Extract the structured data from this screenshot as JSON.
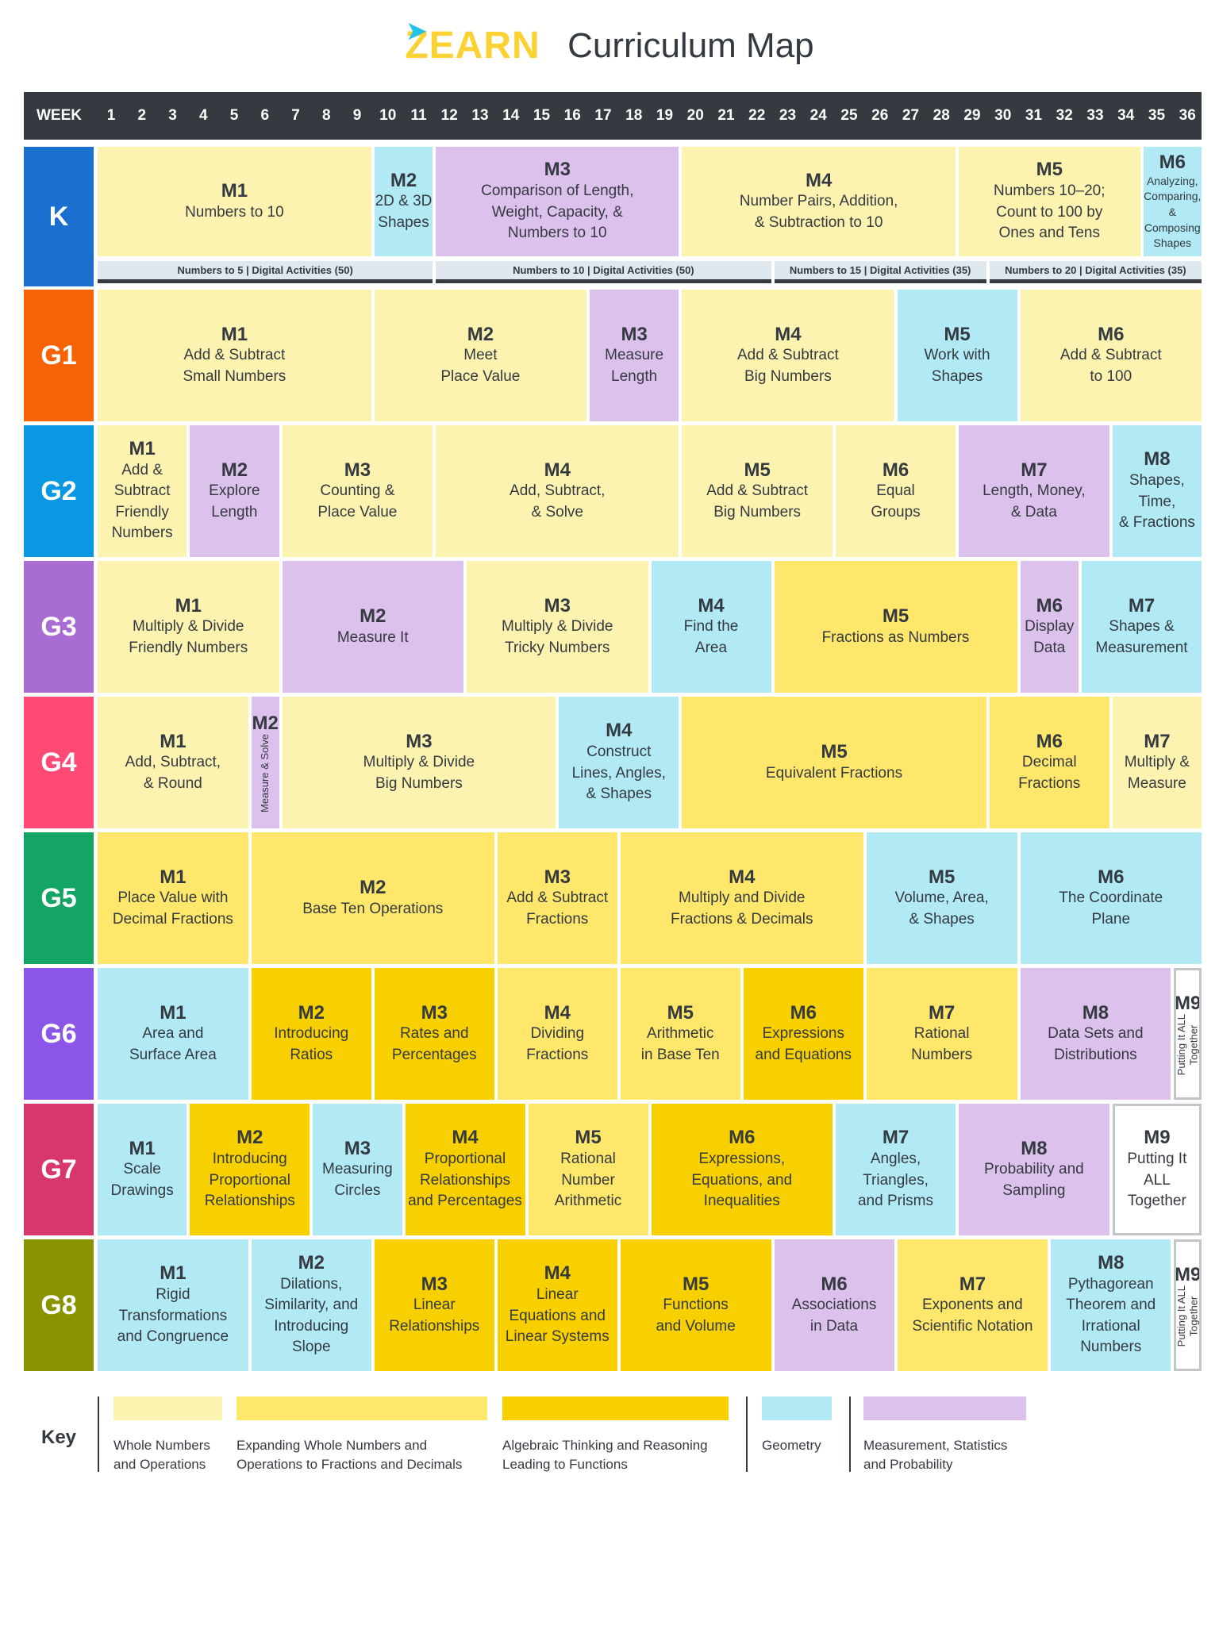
{
  "header": {
    "logo_text": "ZEARN",
    "title": "Curriculum Map"
  },
  "week_bar": {
    "label": "WEEK",
    "weeks": [
      "1",
      "2",
      "3",
      "4",
      "5",
      "6",
      "7",
      "8",
      "9",
      "10",
      "11",
      "12",
      "13",
      "14",
      "15",
      "16",
      "17",
      "18",
      "19",
      "20",
      "21",
      "22",
      "23",
      "24",
      "25",
      "26",
      "27",
      "28",
      "29",
      "30",
      "31",
      "32",
      "33",
      "34",
      "35",
      "36"
    ]
  },
  "colors": {
    "whole": "#fdf3b0",
    "expanding": "#fee76a",
    "algebraic": "#f8d000",
    "geometry": "#b1eaf5",
    "measurement": "#dbc1ec",
    "outline": "#ffffff",
    "header_bg": "#343a40"
  },
  "grades": [
    {
      "label": "K",
      "color": "#1b6fce",
      "modules": [
        {
          "code": "M1",
          "name": "Numbers to 10",
          "start": 1,
          "end": 9,
          "cat": "whole"
        },
        {
          "code": "M2",
          "name": "2D & 3D\nShapes",
          "start": 10,
          "end": 11,
          "cat": "geometry"
        },
        {
          "code": "M3",
          "name": "Comparison of Length,\nWeight, Capacity, &\nNumbers to 10",
          "start": 12,
          "end": 19,
          "cat": "measurement"
        },
        {
          "code": "M4",
          "name": "Number Pairs, Addition,\n& Subtraction to 10",
          "start": 20,
          "end": 28,
          "cat": "whole"
        },
        {
          "code": "M5",
          "name": "Numbers 10–20;\nCount to 100 by\nOnes and Tens",
          "start": 29,
          "end": 34,
          "cat": "whole"
        },
        {
          "code": "M6",
          "name": "Analyzing,\nComparing,\n& Composing\nShapes",
          "start": 35,
          "end": 36,
          "cat": "geometry",
          "style": "small"
        }
      ],
      "subbars": [
        {
          "text": "Numbers to 5 | Digital Activities (50)",
          "start": 1,
          "end": 11
        },
        {
          "text": "Numbers to 10 | Digital Activities (50)",
          "start": 12,
          "end": 22
        },
        {
          "text": "Numbers to 15 | Digital Activities (35)",
          "start": 23,
          "end": 29
        },
        {
          "text": "Numbers to 20 | Digital Activities (35)",
          "start": 30,
          "end": 36
        }
      ]
    },
    {
      "label": "G1",
      "color": "#f66304",
      "modules": [
        {
          "code": "M1",
          "name": "Add & Subtract\nSmall Numbers",
          "start": 1,
          "end": 9,
          "cat": "whole"
        },
        {
          "code": "M2",
          "name": "Meet\nPlace Value",
          "start": 10,
          "end": 16,
          "cat": "whole"
        },
        {
          "code": "M3",
          "name": "Measure\nLength",
          "start": 17,
          "end": 19,
          "cat": "measurement"
        },
        {
          "code": "M4",
          "name": "Add & Subtract\nBig Numbers",
          "start": 20,
          "end": 26,
          "cat": "whole"
        },
        {
          "code": "M5",
          "name": "Work with\nShapes",
          "start": 27,
          "end": 30,
          "cat": "geometry"
        },
        {
          "code": "M6",
          "name": "Add & Subtract\nto 100",
          "start": 31,
          "end": 36,
          "cat": "whole"
        }
      ]
    },
    {
      "label": "G2",
      "color": "#0a98e3",
      "modules": [
        {
          "code": "M1",
          "name": "Add &\nSubtract\nFriendly\nNumbers",
          "start": 1,
          "end": 3,
          "cat": "whole"
        },
        {
          "code": "M2",
          "name": "Explore\nLength",
          "start": 4,
          "end": 6,
          "cat": "measurement"
        },
        {
          "code": "M3",
          "name": "Counting &\nPlace Value",
          "start": 7,
          "end": 11,
          "cat": "whole"
        },
        {
          "code": "M4",
          "name": "Add, Subtract,\n& Solve",
          "start": 12,
          "end": 19,
          "cat": "whole"
        },
        {
          "code": "M5",
          "name": "Add & Subtract\nBig Numbers",
          "start": 20,
          "end": 24,
          "cat": "whole"
        },
        {
          "code": "M6",
          "name": "Equal\nGroups",
          "start": 25,
          "end": 28,
          "cat": "whole"
        },
        {
          "code": "M7",
          "name": "Length, Money,\n& Data",
          "start": 29,
          "end": 33,
          "cat": "measurement"
        },
        {
          "code": "M8",
          "name": "Shapes,\nTime,\n& Fractions",
          "start": 34,
          "end": 36,
          "cat": "geometry"
        }
      ]
    },
    {
      "label": "G3",
      "color": "#a86cd2",
      "modules": [
        {
          "code": "M1",
          "name": "Multiply & Divide\nFriendly Numbers",
          "start": 1,
          "end": 6,
          "cat": "whole"
        },
        {
          "code": "M2",
          "name": "Measure It",
          "start": 7,
          "end": 12,
          "cat": "measurement"
        },
        {
          "code": "M3",
          "name": "Multiply & Divide\nTricky Numbers",
          "start": 13,
          "end": 18,
          "cat": "whole"
        },
        {
          "code": "M4",
          "name": "Find the\nArea",
          "start": 19,
          "end": 22,
          "cat": "geometry"
        },
        {
          "code": "M5",
          "name": "Fractions as Numbers",
          "start": 23,
          "end": 30,
          "cat": "expanding"
        },
        {
          "code": "M6",
          "name": "Display\nData",
          "start": 31,
          "end": 32,
          "cat": "measurement"
        },
        {
          "code": "M7",
          "name": "Shapes &\nMeasurement",
          "start": 33,
          "end": 36,
          "cat": "geometry"
        }
      ]
    },
    {
      "label": "G4",
      "color": "#fe4a74",
      "modules": [
        {
          "code": "M1",
          "name": "Add, Subtract,\n& Round",
          "start": 1,
          "end": 5,
          "cat": "whole"
        },
        {
          "code": "M2",
          "name": "Measure & Solve",
          "start": 6,
          "end": 6,
          "cat": "measurement",
          "style": "vert"
        },
        {
          "code": "M3",
          "name": "Multiply & Divide\nBig Numbers",
          "start": 7,
          "end": 15,
          "cat": "whole"
        },
        {
          "code": "M4",
          "name": "Construct\nLines, Angles,\n& Shapes",
          "start": 16,
          "end": 19,
          "cat": "geometry"
        },
        {
          "code": "M5",
          "name": "Equivalent Fractions",
          "start": 20,
          "end": 29,
          "cat": "expanding"
        },
        {
          "code": "M6",
          "name": "Decimal\nFractions",
          "start": 30,
          "end": 33,
          "cat": "expanding"
        },
        {
          "code": "M7",
          "name": "Multiply &\nMeasure",
          "start": 34,
          "end": 36,
          "cat": "whole"
        }
      ]
    },
    {
      "label": "G5",
      "color": "#14a463",
      "modules": [
        {
          "code": "M1",
          "name": "Place Value with\nDecimal Fractions",
          "start": 1,
          "end": 5,
          "cat": "expanding"
        },
        {
          "code": "M2",
          "name": "Base Ten Operations",
          "start": 6,
          "end": 13,
          "cat": "expanding"
        },
        {
          "code": "M3",
          "name": "Add & Subtract\nFractions",
          "start": 14,
          "end": 17,
          "cat": "expanding"
        },
        {
          "code": "M4",
          "name": "Multiply and Divide\nFractions & Decimals",
          "start": 18,
          "end": 25,
          "cat": "expanding"
        },
        {
          "code": "M5",
          "name": "Volume, Area,\n& Shapes",
          "start": 26,
          "end": 30,
          "cat": "geometry"
        },
        {
          "code": "M6",
          "name": "The Coordinate\nPlane",
          "start": 31,
          "end": 36,
          "cat": "geometry"
        }
      ]
    },
    {
      "label": "G6",
      "color": "#8b56e8",
      "modules": [
        {
          "code": "M1",
          "name": "Area and\nSurface Area",
          "start": 1,
          "end": 5,
          "cat": "geometry"
        },
        {
          "code": "M2",
          "name": "Introducing\nRatios",
          "start": 6,
          "end": 9,
          "cat": "algebraic"
        },
        {
          "code": "M3",
          "name": "Rates and\nPercentages",
          "start": 10,
          "end": 13,
          "cat": "algebraic"
        },
        {
          "code": "M4",
          "name": "Dividing\nFractions",
          "start": 14,
          "end": 17,
          "cat": "expanding"
        },
        {
          "code": "M5",
          "name": "Arithmetic\nin Base Ten",
          "start": 18,
          "end": 21,
          "cat": "expanding"
        },
        {
          "code": "M6",
          "name": "Expressions\nand Equations",
          "start": 22,
          "end": 25,
          "cat": "algebraic"
        },
        {
          "code": "M7",
          "name": "Rational\nNumbers",
          "start": 26,
          "end": 30,
          "cat": "expanding"
        },
        {
          "code": "M8",
          "name": "Data Sets and\nDistributions",
          "start": 31,
          "end": 35,
          "cat": "measurement"
        },
        {
          "code": "M9",
          "name": "Putting It ALL\nTogether",
          "start": 36,
          "end": 36,
          "cat": "outline",
          "style": "vert"
        }
      ]
    },
    {
      "label": "G7",
      "color": "#d7376a",
      "modules": [
        {
          "code": "M1",
          "name": "Scale\nDrawings",
          "start": 1,
          "end": 3,
          "cat": "geometry"
        },
        {
          "code": "M2",
          "name": "Introducing\nProportional\nRelationships",
          "start": 4,
          "end": 7,
          "cat": "algebraic"
        },
        {
          "code": "M3",
          "name": "Measuring\nCircles",
          "start": 8,
          "end": 10,
          "cat": "geometry"
        },
        {
          "code": "M4",
          "name": "Proportional\nRelationships\nand Percentages",
          "start": 11,
          "end": 14,
          "cat": "algebraic"
        },
        {
          "code": "M5",
          "name": "Rational\nNumber\nArithmetic",
          "start": 15,
          "end": 18,
          "cat": "expanding"
        },
        {
          "code": "M6",
          "name": "Expressions,\nEquations, and\nInequalities",
          "start": 19,
          "end": 24,
          "cat": "algebraic"
        },
        {
          "code": "M7",
          "name": "Angles,\nTriangles,\nand Prisms",
          "start": 25,
          "end": 28,
          "cat": "geometry"
        },
        {
          "code": "M8",
          "name": "Probability and\nSampling",
          "start": 29,
          "end": 33,
          "cat": "measurement"
        },
        {
          "code": "M9",
          "name": "Putting It\nALL Together",
          "start": 34,
          "end": 36,
          "cat": "outline"
        }
      ]
    },
    {
      "label": "G8",
      "color": "#8a9300",
      "modules": [
        {
          "code": "M1",
          "name": "Rigid\nTransformations\nand Congruence",
          "start": 1,
          "end": 5,
          "cat": "geometry"
        },
        {
          "code": "M2",
          "name": "Dilations,\nSimilarity, and\nIntroducing\nSlope",
          "start": 6,
          "end": 9,
          "cat": "geometry"
        },
        {
          "code": "M3",
          "name": "Linear\nRelationships",
          "start": 10,
          "end": 13,
          "cat": "algebraic"
        },
        {
          "code": "M4",
          "name": "Linear\nEquations and\nLinear Systems",
          "start": 14,
          "end": 17,
          "cat": "algebraic"
        },
        {
          "code": "M5",
          "name": "Functions\nand Volume",
          "start": 18,
          "end": 22,
          "cat": "algebraic"
        },
        {
          "code": "M6",
          "name": "Associations\nin Data",
          "start": 23,
          "end": 26,
          "cat": "measurement"
        },
        {
          "code": "M7",
          "name": "Exponents and\nScientific Notation",
          "start": 27,
          "end": 31,
          "cat": "expanding"
        },
        {
          "code": "M8",
          "name": "Pythagorean\nTheorem and\nIrrational\nNumbers",
          "start": 32,
          "end": 35,
          "cat": "geometry"
        },
        {
          "code": "M9",
          "name": "Putting It ALL\nTogether",
          "start": 36,
          "end": 36,
          "cat": "outline",
          "style": "vert"
        }
      ]
    }
  ],
  "key": {
    "label": "Key",
    "items": [
      {
        "cat": "whole",
        "text": "Whole Numbers\nand Operations"
      },
      {
        "cat": "expanding",
        "text": "Expanding Whole Numbers and\nOperations to Fractions and Decimals"
      },
      {
        "cat": "algebraic",
        "text": "Algebraic Thinking and Reasoning\nLeading to Functions"
      },
      {
        "cat": "geometry",
        "text": "Geometry"
      },
      {
        "cat": "measurement",
        "text": "Measurement, Statistics\nand Probability"
      }
    ]
  }
}
